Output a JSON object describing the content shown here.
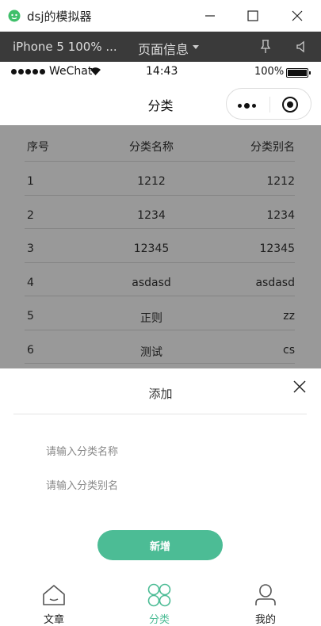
{
  "window": {
    "title": "dsj的模拟器"
  },
  "simulator": {
    "device": "iPhone 5 100% ...",
    "page_info": "页面信息"
  },
  "statusbar": {
    "carrier": "WeChat",
    "time": "14:43",
    "battery": "100%"
  },
  "navbar": {
    "title": "分类"
  },
  "table": {
    "headers": [
      "序号",
      "分类名称",
      "分类别名"
    ],
    "rows": [
      [
        "1",
        "1212",
        "1212"
      ],
      [
        "2",
        "1234",
        "1234"
      ],
      [
        "3",
        "12345",
        "12345"
      ],
      [
        "4",
        "asdasd",
        "asdasd"
      ],
      [
        "5",
        "正则",
        "zz"
      ],
      [
        "6",
        "测试",
        "cs"
      ]
    ]
  },
  "sheet": {
    "title": "添加",
    "name_placeholder": "请输入分类名称",
    "alias_placeholder": "请输入分类别名",
    "submit_label": "新增"
  },
  "tabbar": {
    "items": [
      {
        "label": "文章",
        "icon": "house-icon"
      },
      {
        "label": "分类",
        "icon": "category-grid-icon"
      },
      {
        "label": "我的",
        "icon": "person-icon"
      }
    ],
    "active_color": "#4cbc95"
  }
}
